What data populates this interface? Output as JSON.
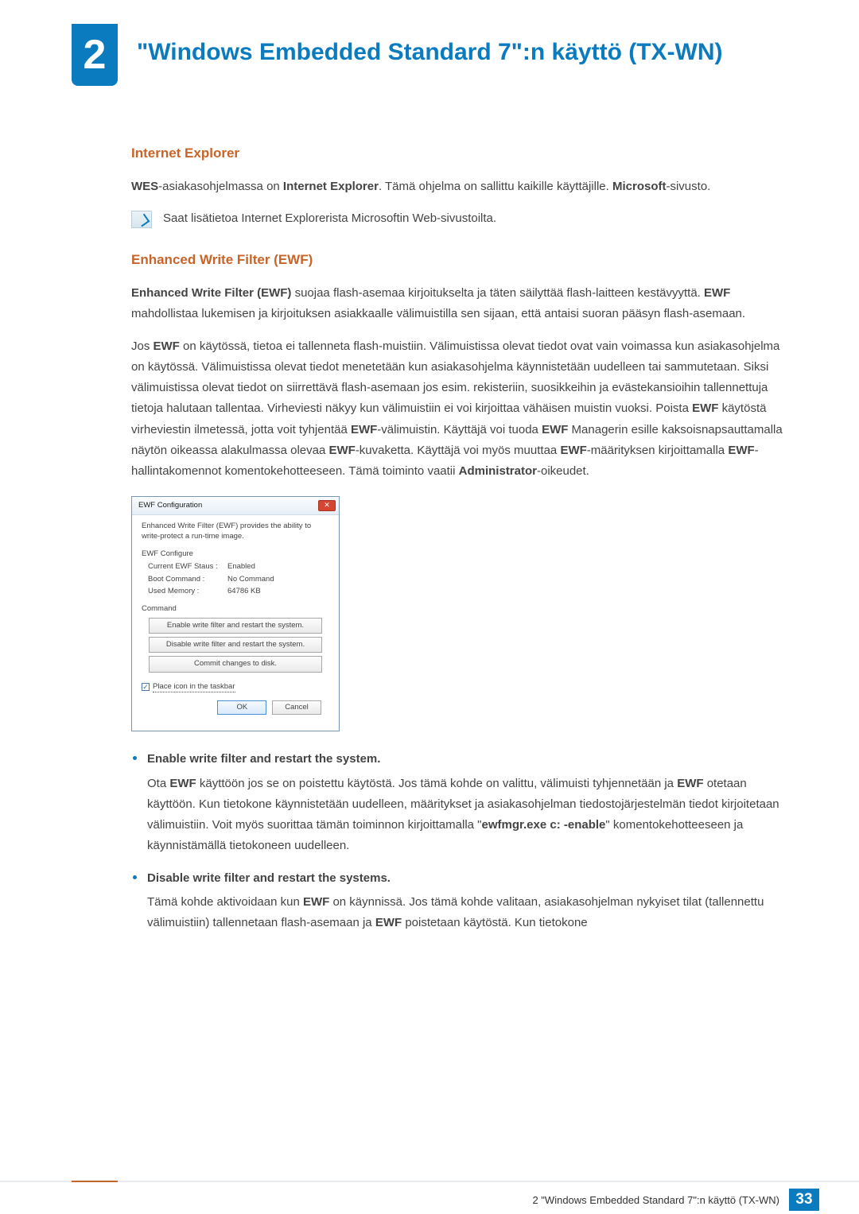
{
  "chapter": {
    "number": "2",
    "title": "\"Windows Embedded Standard 7\":n käyttö (TX-WN)"
  },
  "section_ie": {
    "heading": "Internet Explorer",
    "p1_a": "WES",
    "p1_b": "-asiakasohjelmassa on ",
    "p1_c": "Internet Explorer",
    "p1_d": ". Tämä ohjelma on sallittu kaikille käyttäjille. ",
    "p1_e": "Microsoft",
    "p1_f": "-sivusto.",
    "note": "Saat lisätietoa Internet Explorerista Microsoftin Web-sivustoilta."
  },
  "section_ewf": {
    "heading": "Enhanced Write Filter (EWF)",
    "p1": "Enhanced Write Filter (EWF) suojaa flash-asemaa kirjoitukselta ja täten säilyttää flash-laitteen kestävyyttä. EWF mahdollistaa lukemisen ja kirjoituksen asiakkaalle välimuistilla sen sijaan, että antaisi suoran pääsyn flash-asemaan.",
    "p1_bold1": "Enhanced Write Filter (EWF)",
    "p1_bold2": "EWF",
    "p2": "Jos EWF on käytössä, tietoa ei tallenneta flash-muistiin. Välimuistissa olevat tiedot ovat vain voimassa kun asiakasohjelma on käytössä. Välimuistissa olevat tiedot menetetään kun asiakasohjelma käynnistetään uudelleen tai sammutetaan. Siksi välimuistissa olevat tiedot on siirrettävä flash-asemaan jos esim. rekisteriin, suosikkeihin ja evästekansioihin tallennettuja tietoja halutaan tallentaa. Virheviesti näkyy kun välimuistiin ei voi kirjoittaa vähäisen muistin vuoksi. Poista EWF käytöstä virheviestin ilmetessä, jotta voit tyhjentää EWF-välimuistin. Käyttäjä voi tuoda EWF Managerin esille kaksoisnapsauttamalla näytön oikeassa alakulmassa olevaa EWF-kuvaketta. Käyttäjä voi myös muuttaa EWF-määrityksen kirjoittamalla EWF-hallintakomennot komentokehotteeseen. Tämä toiminto vaatii Administrator-oikeudet."
  },
  "dialog": {
    "title": "EWF Configuration",
    "desc": "Enhanced Write Filter (EWF) provides the ability to write-protect a run-time image.",
    "configure_label": "EWF Configure",
    "status_k": "Current EWF Staus :",
    "status_v": "Enabled",
    "boot_k": "Boot Command :",
    "boot_v": "No Command",
    "mem_k": "Used Memory :",
    "mem_v": "64786 KB",
    "command_label": "Command",
    "btn1": "Enable write filter and restart the system.",
    "btn2": "Disable write filter and restart the system.",
    "btn3": "Commit changes to disk.",
    "checkbox": "Place icon in the taskbar",
    "ok": "OK",
    "cancel": "Cancel"
  },
  "bullets": {
    "b1_title": "Enable write filter and restart the system.",
    "b1_body": "Ota EWF käyttöön jos se on poistettu käytöstä. Jos tämä kohde on valittu, välimuisti tyhjennetään ja EWF otetaan käyttöön. Kun tietokone käynnistetään uudelleen, määritykset ja asiakasohjelman tiedostojärjestelmän tiedot kirjoitetaan välimuistiin. Voit myös suorittaa tämän toiminnon kirjoittamalla \"ewfmgr.exe c: -enable\" komentokehotteeseen ja käynnistämällä tietokoneen uudelleen.",
    "b2_title": "Disable write filter and restart the systems.",
    "b2_body": "Tämä kohde aktivoidaan kun EWF on käynnissä. Jos tämä kohde valitaan, asiakasohjelman nykyiset tilat (tallennettu välimuistiin) tallennetaan flash-asemaan ja EWF poistetaan käytöstä. Kun tietokone"
  },
  "footer": {
    "text": "2 \"Windows Embedded Standard 7\":n käyttö (TX-WN)",
    "page": "33"
  }
}
